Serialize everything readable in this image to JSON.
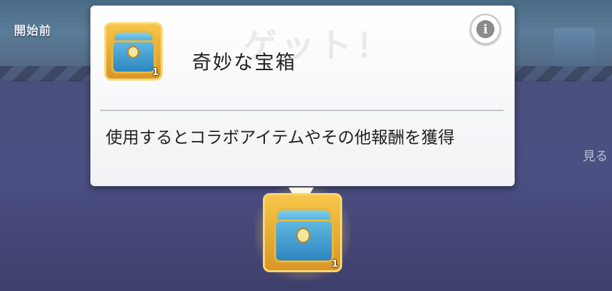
{
  "background": {
    "start_label": "開始前",
    "right_text": "見る"
  },
  "popup": {
    "ghost_text": "ゲット！",
    "item_title": "奇妙な宝箱",
    "item_count": "1",
    "description": "使用するとコラボアイテムやその他報酬を獲得",
    "info_icon": "i"
  },
  "reward": {
    "count": "1"
  }
}
